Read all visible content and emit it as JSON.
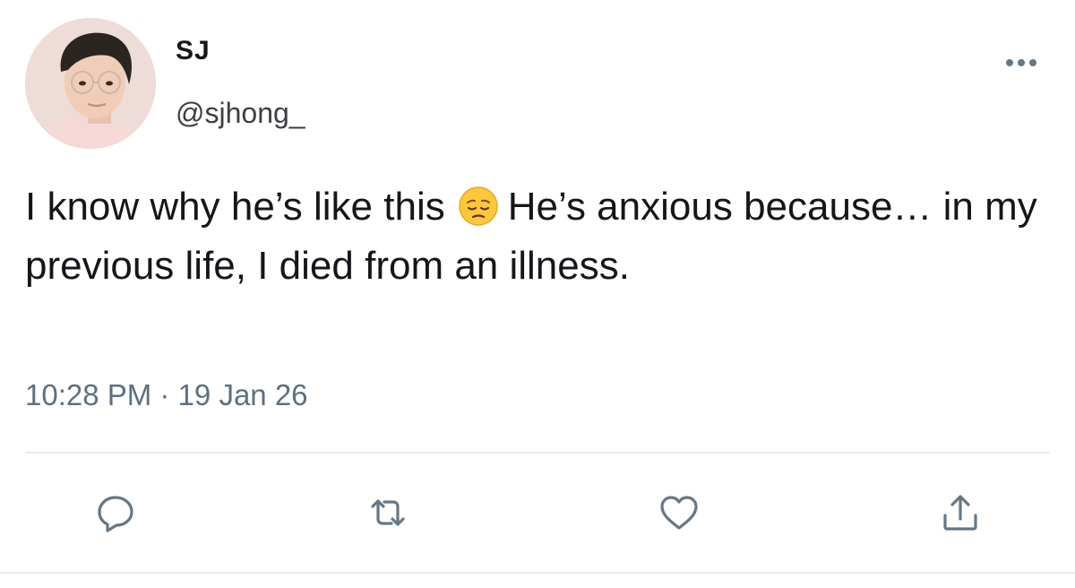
{
  "tweet": {
    "display_name": "SJ",
    "handle": "@sjhong_",
    "text_part1": "I know why he’s like this",
    "text_part2": "He’s anxious because… in my previous life, I died from an illness.",
    "emoji": "pensive-face-emoji",
    "timestamp": "10:28 PM · 19 Jan 26"
  },
  "icons": {
    "more": "more-options-icon",
    "reply": "reply-icon",
    "retweet": "retweet-icon",
    "like": "heart-icon",
    "share": "share-icon"
  },
  "colors": {
    "text": "#14171a",
    "secondary": "#5b7083",
    "icon": "#657786",
    "divider": "#e6ecf0"
  }
}
